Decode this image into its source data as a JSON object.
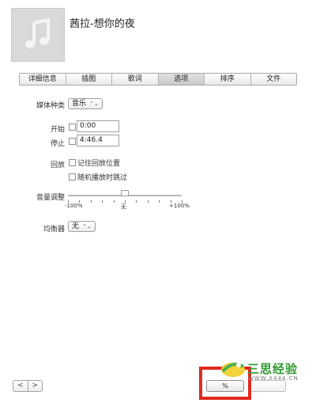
{
  "song": {
    "title": "茜拉-想你的夜",
    "artwork_icon": "music-note-icon"
  },
  "tabs": [
    {
      "label": "详细信息"
    },
    {
      "label": "插图"
    },
    {
      "label": "歌词"
    },
    {
      "label": "选项",
      "active": true
    },
    {
      "label": "排序"
    },
    {
      "label": "文件"
    }
  ],
  "options": {
    "media_kind_label": "媒体种类",
    "media_kind_value": "音乐",
    "start_label": "开始",
    "start_value": "0:00",
    "stop_label": "停止",
    "stop_value": "4:46.4",
    "playback_label": "回放",
    "remember_position": "记住回放位置",
    "skip_shuffle": "随机播放时跳过",
    "volume_label": "音量调整",
    "volume_min": "-100%",
    "volume_mid": "无",
    "volume_max": "+100%",
    "volume_level": 0.5,
    "equalizer_label": "均衡器",
    "equalizer_value": "无"
  },
  "footer": {
    "prev_icon": "chevron-left-icon",
    "next_icon": "chevron-right-icon",
    "prev_label": "<",
    "next_label": ">",
    "ok_label": "%"
  },
  "watermark": {
    "text": "三思经验",
    "url": "WWW.X444.CN"
  },
  "colors": {
    "highlight": "#e02a20",
    "watermark_green": "#2e9a2e"
  }
}
